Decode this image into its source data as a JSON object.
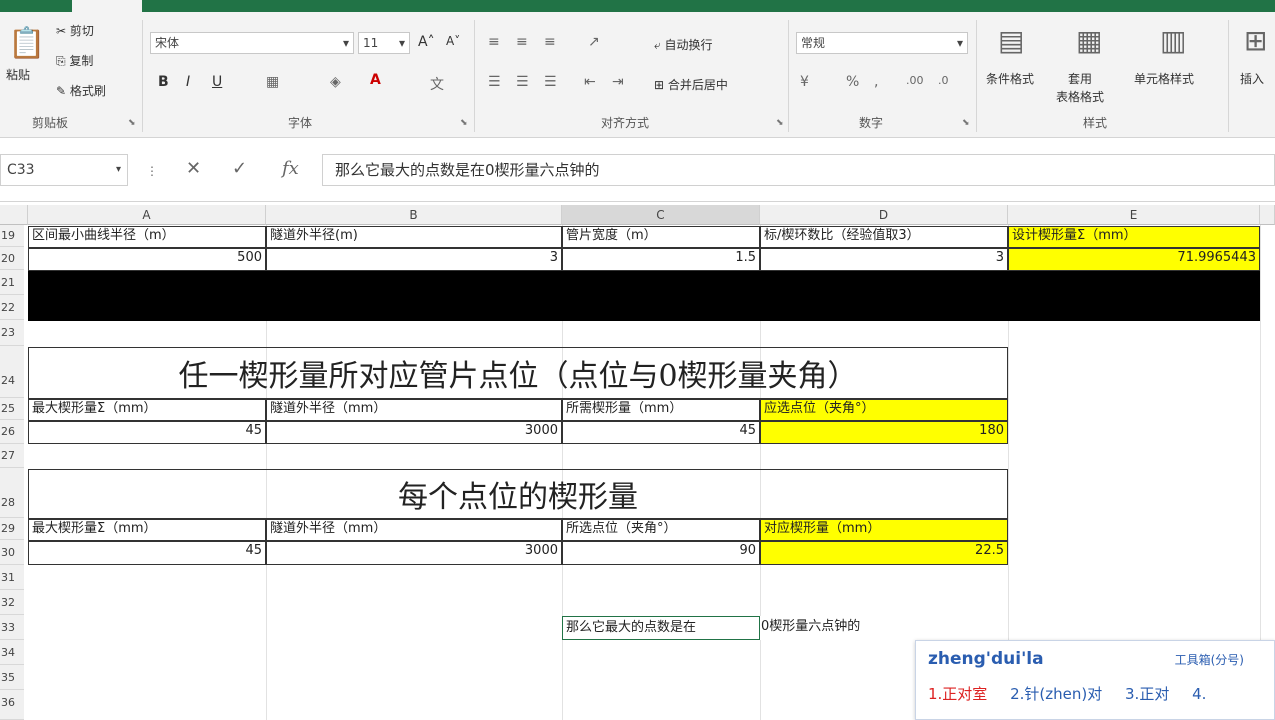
{
  "ribbon": {
    "clipboard": {
      "paste": "粘贴",
      "cut": "剪切",
      "copy": "复制",
      "format_painter": "格式刷",
      "group": "剪贴板"
    },
    "font": {
      "name": "宋体",
      "size": "11",
      "bold": "B",
      "italic": "I",
      "underline": "U",
      "group": "字体"
    },
    "alignment": {
      "wrap": "自动换行",
      "merge": "合并后居中",
      "group": "对齐方式"
    },
    "number": {
      "format": "常规",
      "group": "数字"
    },
    "styles": {
      "cond": "条件格式",
      "table": "套用\n表格格式",
      "cell": "单元格样式",
      "group": "样式"
    },
    "cells": {
      "insert": "插入"
    }
  },
  "formula_bar": {
    "name_box": "C33",
    "content": "那么它最大的点数是在0楔形量六点钟的"
  },
  "columns": [
    "A",
    "B",
    "C",
    "D",
    "E"
  ],
  "rows": {
    "r19": {
      "num": "19",
      "a": "区间最小曲线半径（m）",
      "b": "隧道外半径(m)",
      "c": "管片宽度（m）",
      "d": "标/楔环数比（经验值取3）",
      "e": "设计楔形量Σ（mm）"
    },
    "r20": {
      "num": "20",
      "a": "500",
      "b": "3",
      "c": "1.5",
      "d": "3",
      "e": "71.9965443"
    },
    "r21": {
      "num": "21"
    },
    "r22": {
      "num": "22"
    },
    "r23": {
      "num": "23"
    },
    "r24": {
      "num": "24",
      "title": "任一楔形量所对应管片点位（点位与0楔形量夹角）"
    },
    "r25": {
      "num": "25",
      "a": "最大楔形量Σ（mm）",
      "b": "隧道外半径（mm）",
      "c": "所需楔形量（mm）",
      "d": "应选点位（夹角°）"
    },
    "r26": {
      "num": "26",
      "a": "45",
      "b": "3000",
      "c": "45",
      "d": "180"
    },
    "r27": {
      "num": "27"
    },
    "r28": {
      "num": "28",
      "title": "每个点位的楔形量"
    },
    "r29": {
      "num": "29",
      "a": "最大楔形量Σ（mm）",
      "b": "隧道外半径（mm）",
      "c": "所选点位（夹角°）",
      "d": "对应楔形量（mm）"
    },
    "r30": {
      "num": "30",
      "a": "45",
      "b": "3000",
      "c": "90",
      "d": "22.5"
    },
    "r31": {
      "num": "31"
    },
    "r32": {
      "num": "32"
    },
    "r33": {
      "num": "33",
      "editing_text": "那么它最大的点数是在",
      "overflow_text": "0楔形量六点钟的"
    },
    "r34": {
      "num": "34"
    },
    "r35": {
      "num": "35"
    },
    "r36": {
      "num": "36"
    }
  },
  "ime": {
    "input": "zheng'dui'la",
    "toolbox": "工具箱(分号)",
    "candidates": [
      "1.正对室",
      "2.针(zhen)对",
      "3.正对",
      "4."
    ]
  }
}
